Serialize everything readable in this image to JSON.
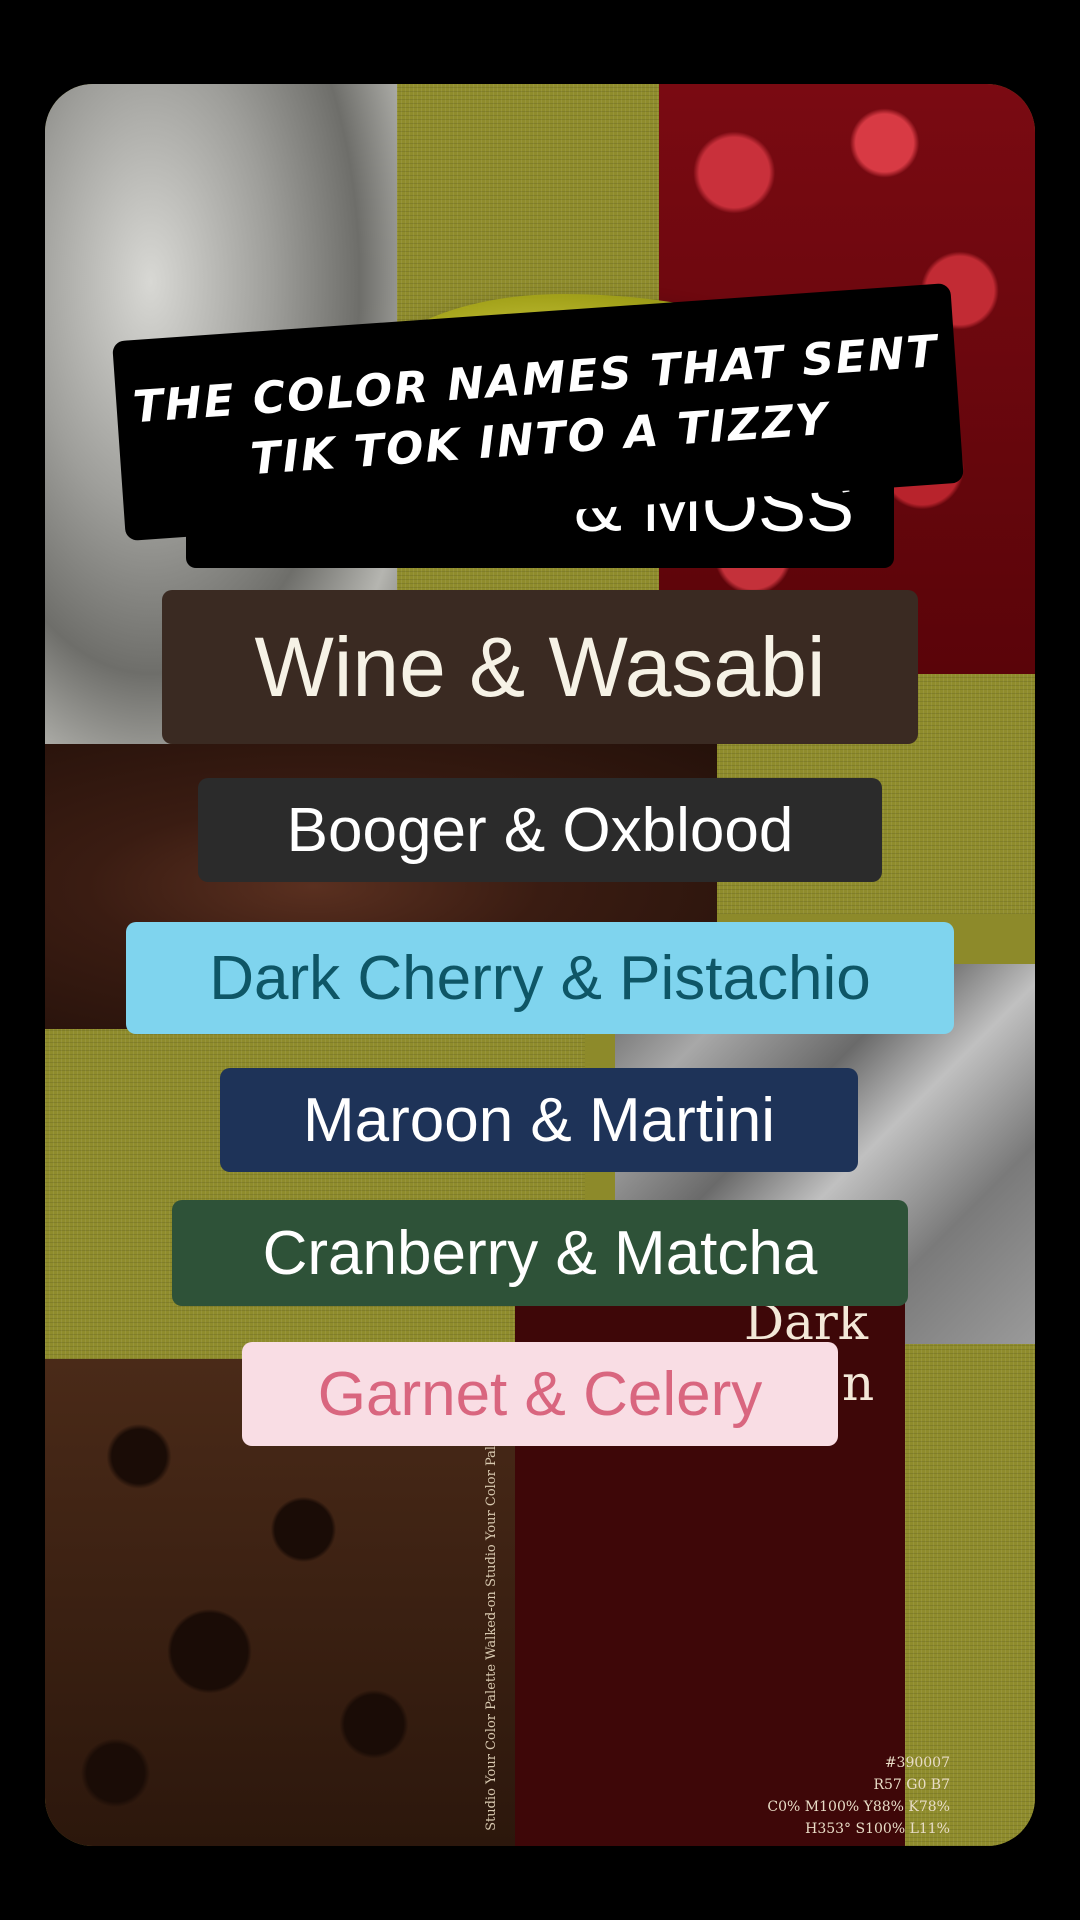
{
  "headline": "The color names that sent Tik Tok into a tizzy",
  "partial_label": "& MOSS",
  "labels": [
    {
      "text": "Wine & Wasabi",
      "bg": "#3a2a22",
      "fg": "#f6f2e6"
    },
    {
      "text": "Booger & Oxblood",
      "bg": "#2b2b2b",
      "fg": "#ffffff"
    },
    {
      "text": "Dark Cherry & Pistachio",
      "bg": "#7fd4ee",
      "fg": "#0e5666"
    },
    {
      "text": "Maroon & Martini",
      "bg": "#1e3358",
      "fg": "#ffffff"
    },
    {
      "text": "Cranberry & Matcha",
      "bg": "#2e5238",
      "fg": "#ffffff"
    },
    {
      "text": "Garnet & Celery",
      "bg": "#f9dde4",
      "fg": "#d9667f"
    }
  ],
  "swatch": {
    "title_line1": "Dark",
    "title_line2": "n",
    "hex": "#390007",
    "rgb": "R57 G0 B7",
    "cmyk": "C0% M100% Y88% K78%",
    "hsl": "H353° S100% L11%",
    "spine": "Studio   Your Color Palette   Walked-on Studio   Your Color Palette"
  }
}
